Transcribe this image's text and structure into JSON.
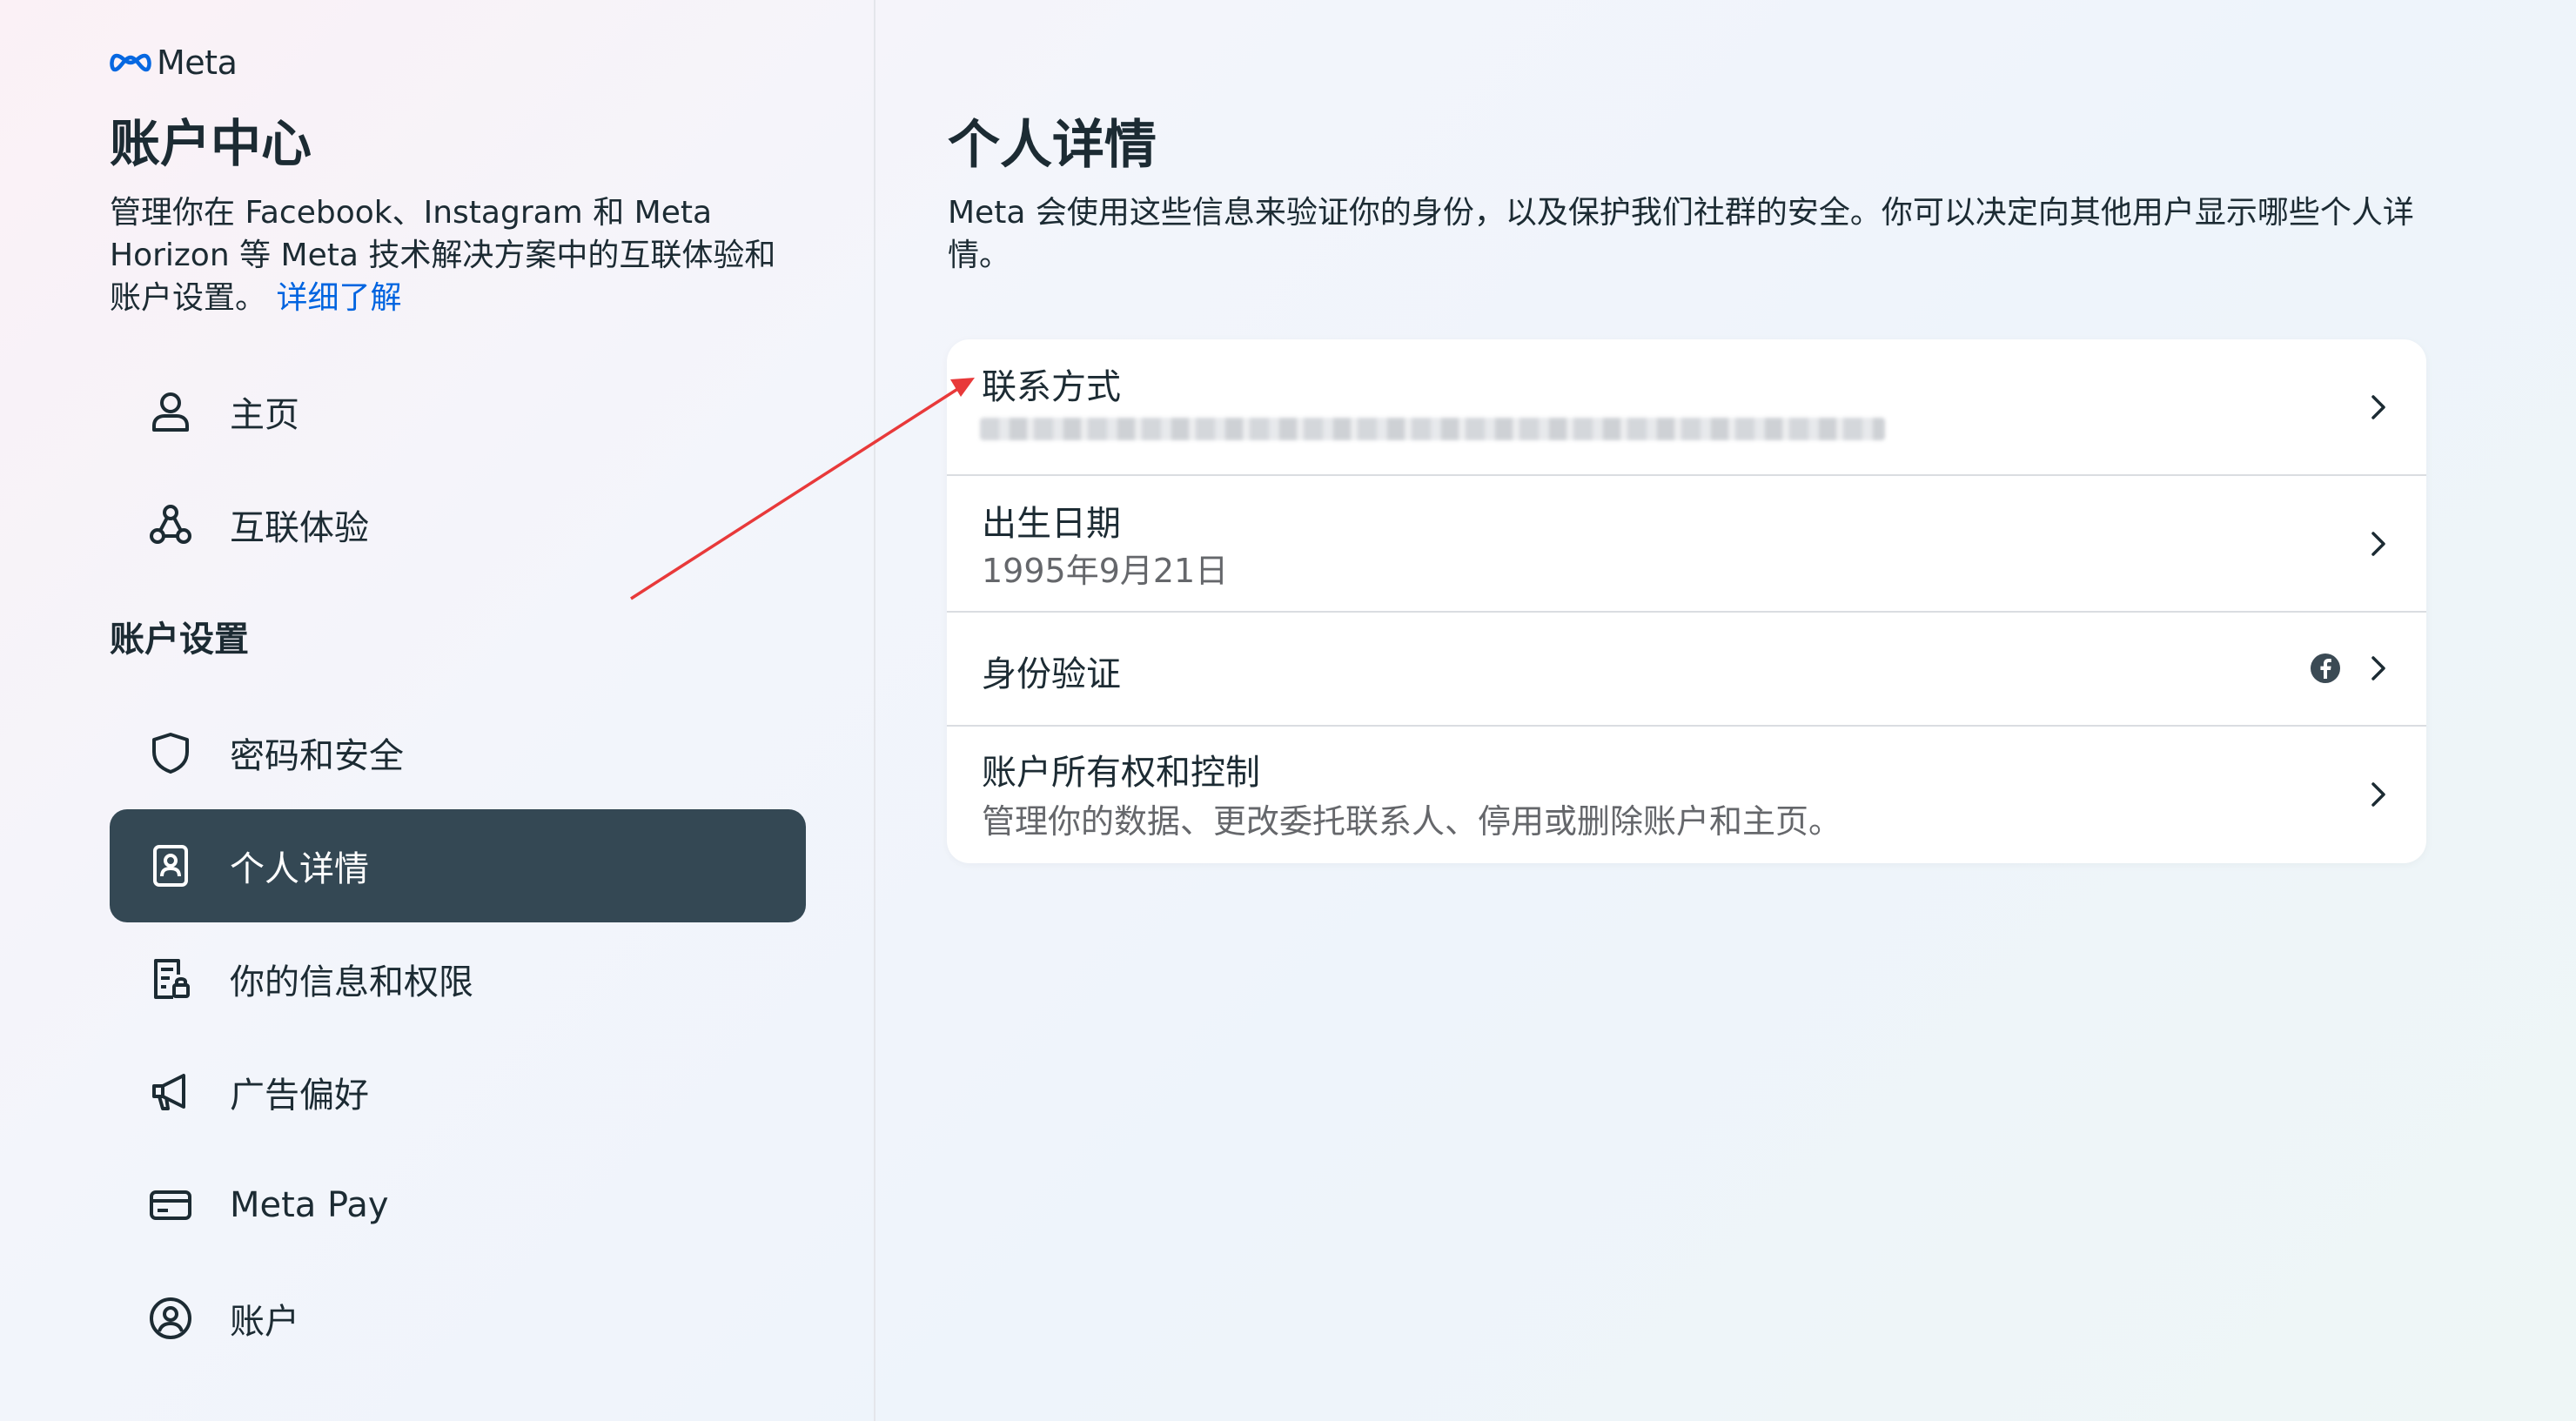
{
  "brand": {
    "logo_text": "Meta"
  },
  "sidebar": {
    "title": "账户中心",
    "description": "管理你在 Facebook、Instagram 和 Meta Horizon 等 Meta 技术解决方案中的互联体验和账户设置。",
    "learn_more": "详细了解",
    "top_items": [
      {
        "label": "主页",
        "icon": "person-icon"
      },
      {
        "label": "互联体验",
        "icon": "connected-experiences-icon"
      }
    ],
    "section_heading": "账户设置",
    "settings_items": [
      {
        "label": "密码和安全",
        "icon": "shield-icon",
        "active": false
      },
      {
        "label": "个人详情",
        "icon": "id-card-icon",
        "active": true
      },
      {
        "label": "你的信息和权限",
        "icon": "document-lock-icon",
        "active": false
      },
      {
        "label": "广告偏好",
        "icon": "megaphone-icon",
        "active": false
      },
      {
        "label": "Meta Pay",
        "icon": "card-icon",
        "active": false
      },
      {
        "label": "账户",
        "icon": "account-circle-icon",
        "active": false
      }
    ]
  },
  "main": {
    "title": "个人详情",
    "description": "Meta 会使用这些信息来验证你的身份，以及保护我们社群的安全。你可以决定向其他用户显示哪些个人详情。",
    "rows": [
      {
        "title": "联系方式",
        "subtitle": "",
        "redacted": true
      },
      {
        "title": "出生日期",
        "subtitle": "1995年9月21日"
      },
      {
        "title": "身份验证",
        "subtitle": "",
        "badge_icon": "facebook-icon"
      },
      {
        "title": "账户所有权和控制",
        "subtitle": "管理你的数据、更改委托联系人、停用或删除账户和主页。"
      }
    ]
  },
  "colors": {
    "active_nav_bg": "#344854",
    "link": "#0064e0",
    "annotation_arrow": "#e8393a"
  }
}
